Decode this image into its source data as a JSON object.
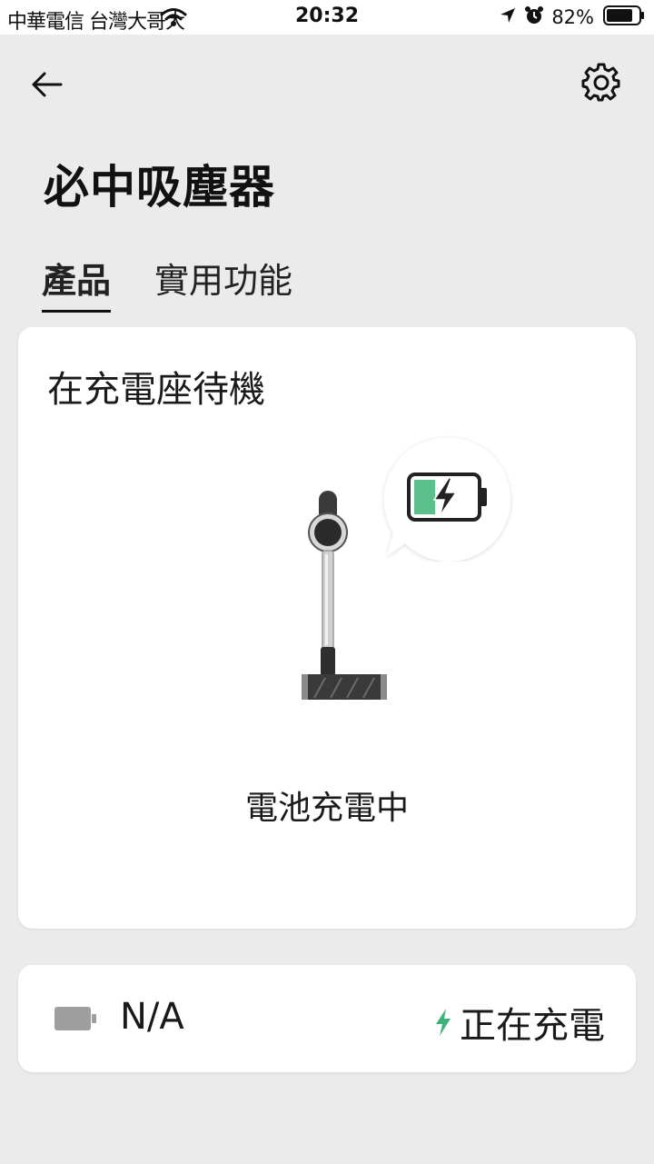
{
  "status_bar": {
    "carrier": "中華電信 台灣大哥大",
    "time": "20:32",
    "battery_percent": "82%"
  },
  "header": {
    "title": "必中吸塵器",
    "back_icon": "arrow-left-icon",
    "settings_icon": "gear-icon"
  },
  "tabs": [
    {
      "label": "產品",
      "active": true
    },
    {
      "label": "實用功能",
      "active": false
    }
  ],
  "status_card": {
    "title": "在充電座待機",
    "status_text": "電池充電中",
    "battery_fill_fraction": 0.35,
    "accent_color": "#5cc08d"
  },
  "info_card": {
    "battery_value": "N/A",
    "charging_label": "正在充電",
    "charging_icon_color": "#3fb377"
  }
}
